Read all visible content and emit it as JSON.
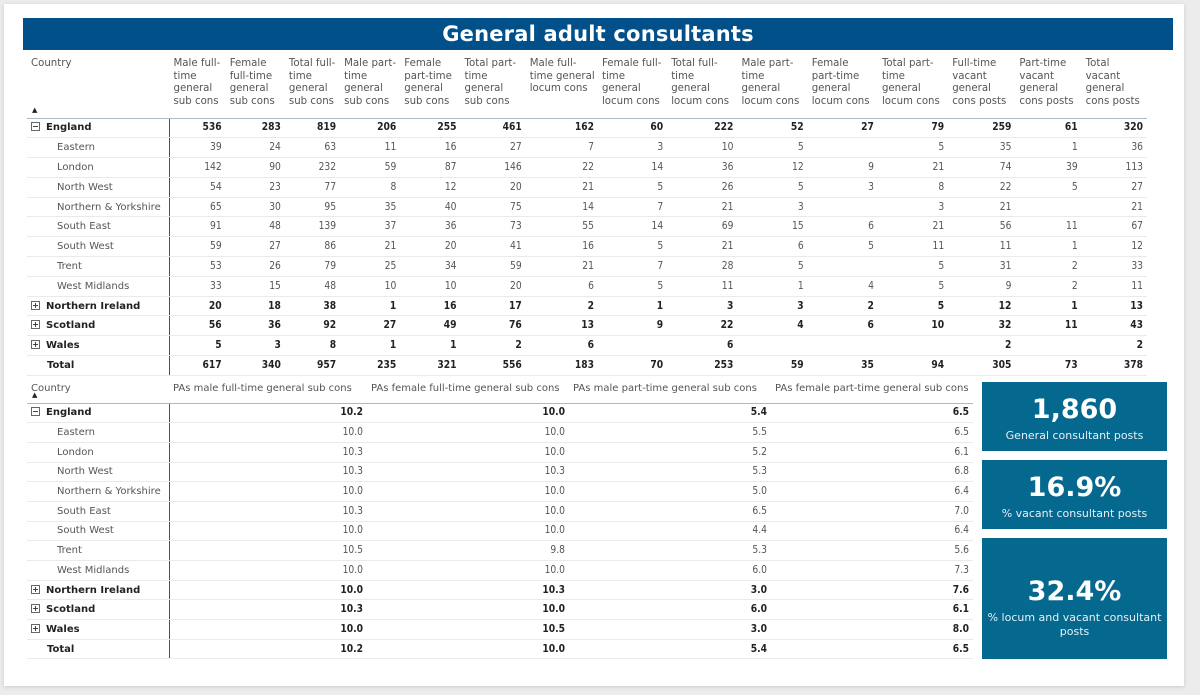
{
  "title": "General adult consultants",
  "table1": {
    "country_header": "Country",
    "columns": [
      "Male full-time general sub cons",
      "Female full-time general sub cons",
      "Total full-time general sub cons",
      "Male part-time general sub cons",
      "Female part-time general sub cons",
      "Total part-time general sub cons",
      "Male full-time general locum cons",
      "Female full-time general locum cons",
      "Total full-time general locum cons",
      "Male part-time general locum cons",
      "Female part-time general locum cons",
      "Total part-time general locum cons",
      "Full-time vacant general cons posts",
      "Part-time vacant general cons posts",
      "Total vacant general cons posts"
    ],
    "rows": [
      {
        "name": "England",
        "level": "parent",
        "toggle": "collapse",
        "values": [
          "536",
          "283",
          "819",
          "206",
          "255",
          "461",
          "162",
          "60",
          "222",
          "52",
          "27",
          "79",
          "259",
          "61",
          "320"
        ]
      },
      {
        "name": "Eastern",
        "level": "child",
        "values": [
          "39",
          "24",
          "63",
          "11",
          "16",
          "27",
          "7",
          "3",
          "10",
          "5",
          "",
          "5",
          "35",
          "1",
          "36"
        ]
      },
      {
        "name": "London",
        "level": "child",
        "values": [
          "142",
          "90",
          "232",
          "59",
          "87",
          "146",
          "22",
          "14",
          "36",
          "12",
          "9",
          "21",
          "74",
          "39",
          "113"
        ]
      },
      {
        "name": "North West",
        "level": "child",
        "values": [
          "54",
          "23",
          "77",
          "8",
          "12",
          "20",
          "21",
          "5",
          "26",
          "5",
          "3",
          "8",
          "22",
          "5",
          "27"
        ]
      },
      {
        "name": "Northern & Yorkshire",
        "level": "child",
        "values": [
          "65",
          "30",
          "95",
          "35",
          "40",
          "75",
          "14",
          "7",
          "21",
          "3",
          "",
          "3",
          "21",
          "",
          "21"
        ]
      },
      {
        "name": "South East",
        "level": "child",
        "values": [
          "91",
          "48",
          "139",
          "37",
          "36",
          "73",
          "55",
          "14",
          "69",
          "15",
          "6",
          "21",
          "56",
          "11",
          "67"
        ]
      },
      {
        "name": "South West",
        "level": "child",
        "values": [
          "59",
          "27",
          "86",
          "21",
          "20",
          "41",
          "16",
          "5",
          "21",
          "6",
          "5",
          "11",
          "11",
          "1",
          "12"
        ]
      },
      {
        "name": "Trent",
        "level": "child",
        "values": [
          "53",
          "26",
          "79",
          "25",
          "34",
          "59",
          "21",
          "7",
          "28",
          "5",
          "",
          "5",
          "31",
          "2",
          "33"
        ]
      },
      {
        "name": "West Midlands",
        "level": "child",
        "values": [
          "33",
          "15",
          "48",
          "10",
          "10",
          "20",
          "6",
          "5",
          "11",
          "1",
          "4",
          "5",
          "9",
          "2",
          "11"
        ]
      },
      {
        "name": "Northern Ireland",
        "level": "parent",
        "toggle": "expand",
        "values": [
          "20",
          "18",
          "38",
          "1",
          "16",
          "17",
          "2",
          "1",
          "3",
          "3",
          "2",
          "5",
          "12",
          "1",
          "13"
        ]
      },
      {
        "name": "Scotland",
        "level": "parent",
        "toggle": "expand",
        "values": [
          "56",
          "36",
          "92",
          "27",
          "49",
          "76",
          "13",
          "9",
          "22",
          "4",
          "6",
          "10",
          "32",
          "11",
          "43"
        ]
      },
      {
        "name": "Wales",
        "level": "parent",
        "toggle": "expand",
        "values": [
          "5",
          "3",
          "8",
          "1",
          "1",
          "2",
          "6",
          "",
          "6",
          "",
          "",
          "",
          "2",
          "",
          "2"
        ]
      },
      {
        "name": "Total",
        "level": "total",
        "values": [
          "617",
          "340",
          "957",
          "235",
          "321",
          "556",
          "183",
          "70",
          "253",
          "59",
          "35",
          "94",
          "305",
          "73",
          "378"
        ]
      }
    ]
  },
  "table2": {
    "country_header": "Country",
    "columns": [
      "PAs male full-time general sub cons",
      "PAs female full-time general sub cons",
      "PAs male part-time general sub cons",
      "PAs female part-time general sub cons"
    ],
    "rows": [
      {
        "name": "England",
        "level": "parent",
        "toggle": "collapse",
        "values": [
          "10.2",
          "10.0",
          "5.4",
          "6.5"
        ]
      },
      {
        "name": "Eastern",
        "level": "child",
        "values": [
          "10.0",
          "10.0",
          "5.5",
          "6.5"
        ]
      },
      {
        "name": "London",
        "level": "child",
        "values": [
          "10.3",
          "10.0",
          "5.2",
          "6.1"
        ]
      },
      {
        "name": "North West",
        "level": "child",
        "values": [
          "10.3",
          "10.3",
          "5.3",
          "6.8"
        ]
      },
      {
        "name": "Northern & Yorkshire",
        "level": "child",
        "values": [
          "10.0",
          "10.0",
          "5.0",
          "6.4"
        ]
      },
      {
        "name": "South East",
        "level": "child",
        "values": [
          "10.3",
          "10.0",
          "6.5",
          "7.0"
        ]
      },
      {
        "name": "South West",
        "level": "child",
        "values": [
          "10.0",
          "10.0",
          "4.4",
          "6.4"
        ]
      },
      {
        "name": "Trent",
        "level": "child",
        "values": [
          "10.5",
          "9.8",
          "5.3",
          "5.6"
        ]
      },
      {
        "name": "West Midlands",
        "level": "child",
        "values": [
          "10.0",
          "10.0",
          "6.0",
          "7.3"
        ]
      },
      {
        "name": "Northern Ireland",
        "level": "parent",
        "toggle": "expand",
        "values": [
          "10.0",
          "10.3",
          "3.0",
          "7.6"
        ]
      },
      {
        "name": "Scotland",
        "level": "parent",
        "toggle": "expand",
        "values": [
          "10.3",
          "10.0",
          "6.0",
          "6.1"
        ]
      },
      {
        "name": "Wales",
        "level": "parent",
        "toggle": "expand",
        "values": [
          "10.0",
          "10.5",
          "3.0",
          "8.0"
        ]
      },
      {
        "name": "Total",
        "level": "total",
        "values": [
          "10.2",
          "10.0",
          "5.4",
          "6.5"
        ]
      }
    ]
  },
  "kpis": [
    {
      "value": "1,860",
      "label": "General consultant posts"
    },
    {
      "value": "16.9%",
      "label": "% vacant consultant posts"
    },
    {
      "value": "32.4%",
      "label": "% locum and vacant consultant posts"
    }
  ],
  "colors": {
    "title_bg": "#02508a",
    "kpi_bg": "#05688f"
  }
}
